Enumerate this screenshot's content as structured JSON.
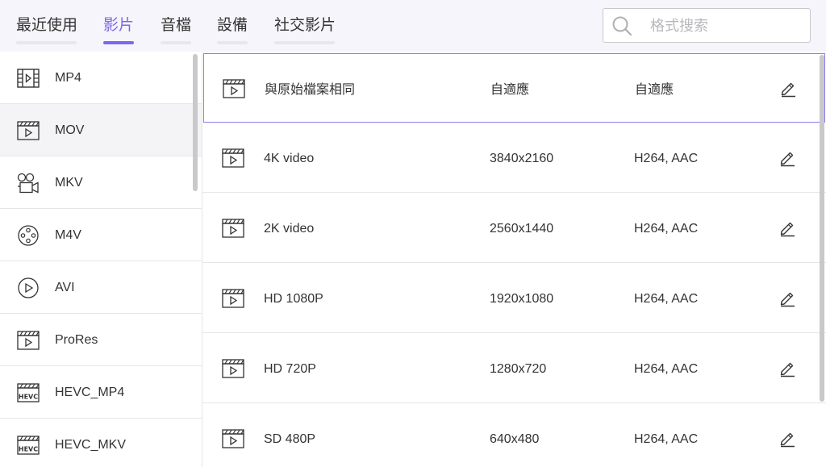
{
  "tabs": [
    {
      "label": "最近使用",
      "active": false
    },
    {
      "label": "影片",
      "active": true
    },
    {
      "label": "音檔",
      "active": false
    },
    {
      "label": "設備",
      "active": false
    },
    {
      "label": "社交影片",
      "active": false
    }
  ],
  "search": {
    "placeholder": "格式搜索",
    "value": ""
  },
  "formats": [
    {
      "name": "MP4",
      "icon": "film-strip-icon",
      "selected": false
    },
    {
      "name": "MOV",
      "icon": "clapperboard-icon",
      "selected": true
    },
    {
      "name": "MKV",
      "icon": "camera-icon",
      "selected": false
    },
    {
      "name": "M4V",
      "icon": "film-reel-icon",
      "selected": false
    },
    {
      "name": "AVI",
      "icon": "play-circle-icon",
      "selected": false
    },
    {
      "name": "ProRes",
      "icon": "clapperboard-icon",
      "selected": false
    },
    {
      "name": "HEVC_MP4",
      "icon": "hevc-icon",
      "selected": false
    },
    {
      "name": "HEVC_MKV",
      "icon": "hevc-icon",
      "selected": false
    }
  ],
  "hevc_badge": "HEVC",
  "presets": [
    {
      "name": "與原始檔案相同",
      "resolution": "自適應",
      "codec": "自適應",
      "selected": true
    },
    {
      "name": "4K video",
      "resolution": "3840x2160",
      "codec": "H264, AAC",
      "selected": false
    },
    {
      "name": "2K video",
      "resolution": "2560x1440",
      "codec": "H264, AAC",
      "selected": false
    },
    {
      "name": "HD 1080P",
      "resolution": "1920x1080",
      "codec": "H264, AAC",
      "selected": false
    },
    {
      "name": "HD 720P",
      "resolution": "1280x720",
      "codec": "H264, AAC",
      "selected": false
    },
    {
      "name": "SD 480P",
      "resolution": "640x480",
      "codec": "H264, AAC",
      "selected": false
    }
  ],
  "colors": {
    "accent": "#7b68ee",
    "text": "#333333",
    "border": "#e6e6e6"
  }
}
